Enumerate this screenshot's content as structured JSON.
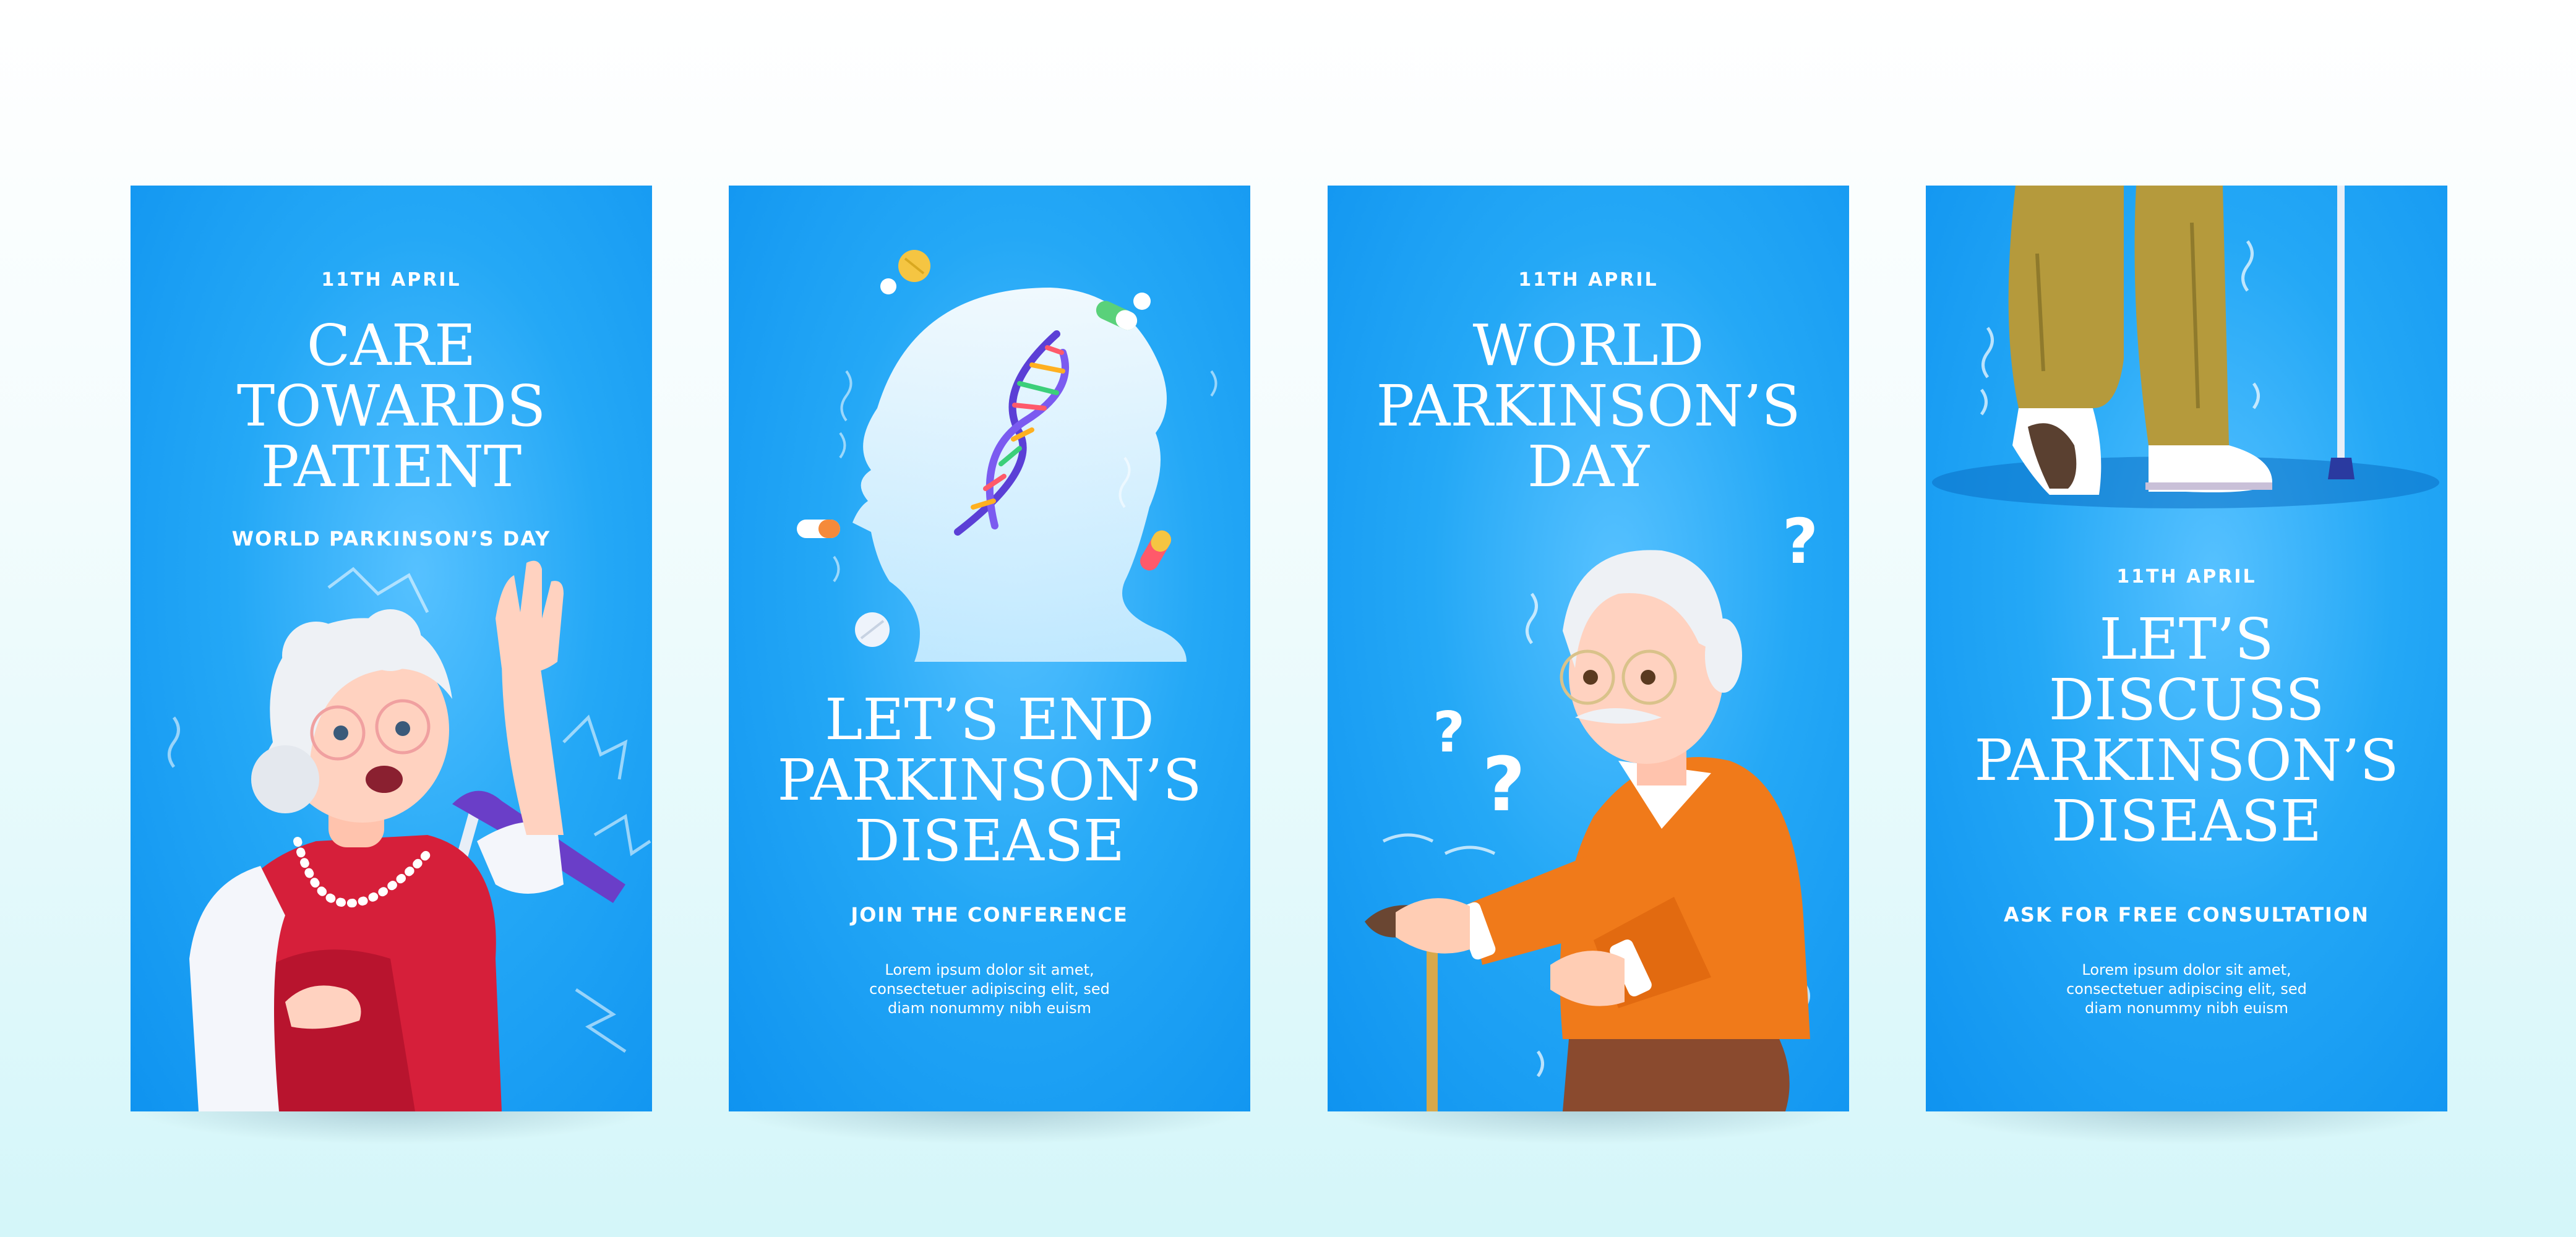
{
  "cards": [
    {
      "date": "11TH APRIL",
      "title_lines": [
        "CARE",
        "TOWARDS",
        "PATIENT"
      ],
      "subtitle": "WORLD PARKINSON’S DAY",
      "illustration": "elderly-woman-with-cane-icon"
    },
    {
      "title_lines": [
        "LET’S END",
        "PARKINSON’S",
        "DISEASE"
      ],
      "subtitle": "JOIN THE CONFERENCE",
      "body_lines": [
        "Lorem ipsum dolor sit amet,",
        "consectetuer adipiscing elit, sed",
        "diam nonummy nibh euism"
      ],
      "illustration": "head-silhouette-with-dna-icon"
    },
    {
      "date": "11TH APRIL",
      "title_lines": [
        "WORLD",
        "PARKINSON’S",
        "DAY"
      ],
      "illustration": "elderly-man-with-cane-icon"
    },
    {
      "date": "11TH APRIL",
      "title_lines": [
        "LET’S",
        "DISCUSS",
        "PARKINSON’S",
        "DISEASE"
      ],
      "subtitle": "ASK FOR FREE CONSULTATION",
      "body_lines": [
        "Lorem ipsum dolor sit amet,",
        "consectetuer adipiscing elit, sed",
        "diam nonummy nibh euism"
      ],
      "illustration": "shaking-legs-with-cane-icon"
    }
  ],
  "colors": {
    "card_blue": "#1aa0f4",
    "card_blue_light": "#56c1ff",
    "text": "#ffffff",
    "woman_dress": "#d61f3a",
    "man_sweater": "#f07a1a",
    "trousers": "#b59a3c"
  }
}
